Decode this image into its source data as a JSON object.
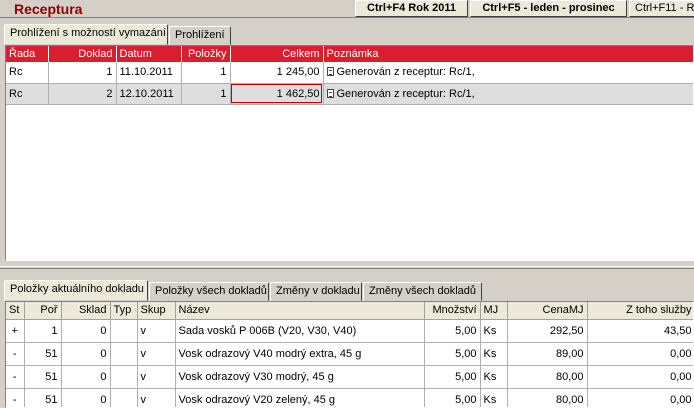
{
  "app": {
    "title": "Receptura"
  },
  "hotkeys": [
    {
      "label": "Ctrl+F4 Rok 2011"
    },
    {
      "label": "Ctrl+F5 - leden - prosinec"
    },
    {
      "label": "Ctrl+F11 - R"
    }
  ],
  "top_tabs": [
    {
      "label": "Prohlížení s možností vymazání"
    },
    {
      "label": "Prohlížení"
    }
  ],
  "top_grid": {
    "columns": [
      "Řada",
      "Doklad",
      "Datum",
      "Položky",
      "Celkem",
      "Poznámka"
    ],
    "rows": [
      {
        "rada": "Rc",
        "doklad": "1",
        "datum": "11.10.2011",
        "polozky": "1",
        "celkem": "1 245,00",
        "poznamka": "Generován z receptur: Rc/1,"
      },
      {
        "rada": "Rc",
        "doklad": "2",
        "datum": "12.10.2011",
        "polozky": "1",
        "celkem": "1 462,50",
        "poznamka": "Generován z receptur: Rc/1,"
      }
    ]
  },
  "bottom_tabs": [
    {
      "label": "Položky aktuálního dokladu"
    },
    {
      "label": "Položky všech dokladů"
    },
    {
      "label": "Změny v dokladu"
    },
    {
      "label": "Změny všech dokladů"
    }
  ],
  "bottom_grid": {
    "columns": [
      "St",
      "Poř",
      "Sklad",
      "Typ",
      "Skup",
      "Název",
      "Množství",
      "MJ",
      "CenaMJ",
      "Z toho služby"
    ],
    "rows": [
      {
        "st": "+",
        "por": "1",
        "sklad": "0",
        "typ": "",
        "skup": "v",
        "nazev": "Sada vosků P 006B (V20, V30, V40)",
        "mnozstvi": "5,00",
        "mj": "Ks",
        "cena": "292,50",
        "sluzby": "43,50"
      },
      {
        "st": "-",
        "por": "51",
        "sklad": "0",
        "typ": "",
        "skup": "v",
        "nazev": "Vosk odrazový V40 modrý extra, 45 g",
        "mnozstvi": "5,00",
        "mj": "Ks",
        "cena": "89,00",
        "sluzby": "0,00"
      },
      {
        "st": "-",
        "por": "51",
        "sklad": "0",
        "typ": "",
        "skup": "v",
        "nazev": "Vosk odrazový V30 modrý, 45 g",
        "mnozstvi": "5,00",
        "mj": "Ks",
        "cena": "80,00",
        "sluzby": "0,00"
      },
      {
        "st": "-",
        "por": "51",
        "sklad": "0",
        "typ": "",
        "skup": "v",
        "nazev": "Vosk odrazový V20 zelený, 45 g",
        "mnozstvi": "5,00",
        "mj": "Ks",
        "cena": "80,00",
        "sluzby": "0,00"
      }
    ]
  },
  "colors": {
    "title": "#8b0000",
    "header_red": "#d81f2f",
    "selected_row": "#dedede"
  }
}
